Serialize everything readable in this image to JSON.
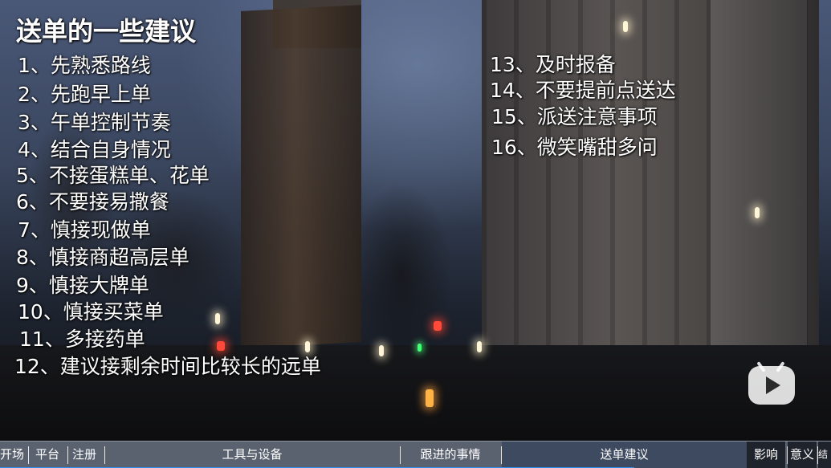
{
  "title": "送单的一些建议",
  "tips_left": [
    "1、先熟悉路线",
    "2、先跑早上单",
    "3、午单控制节奏",
    "4、结合自身情况",
    "5、不接蛋糕单、花单",
    "6、不要接易撒餐",
    "7、慎接现做单",
    "8、慎接商超高层单",
    "9、慎接大牌单",
    "10、慎接买菜单",
    "11、多接药单",
    "12、建议接剩余时间比较长的远单"
  ],
  "tips_right": [
    "13、及时报备",
    "14、不要提前点送达",
    "15、派送注意事项",
    "16、微笑嘴甜多问"
  ],
  "watermark": "bilibili-tv-icon",
  "chapters": [
    "开场",
    "平台",
    "注册",
    "工具与设备",
    "跟进的事情",
    "送单建议",
    "影响",
    "意义",
    "结"
  ],
  "active_chapter": "送单建议",
  "colors": {
    "text": "#ffffff",
    "chapter_bar": "#5a6270",
    "progress": "#2f8df0"
  }
}
